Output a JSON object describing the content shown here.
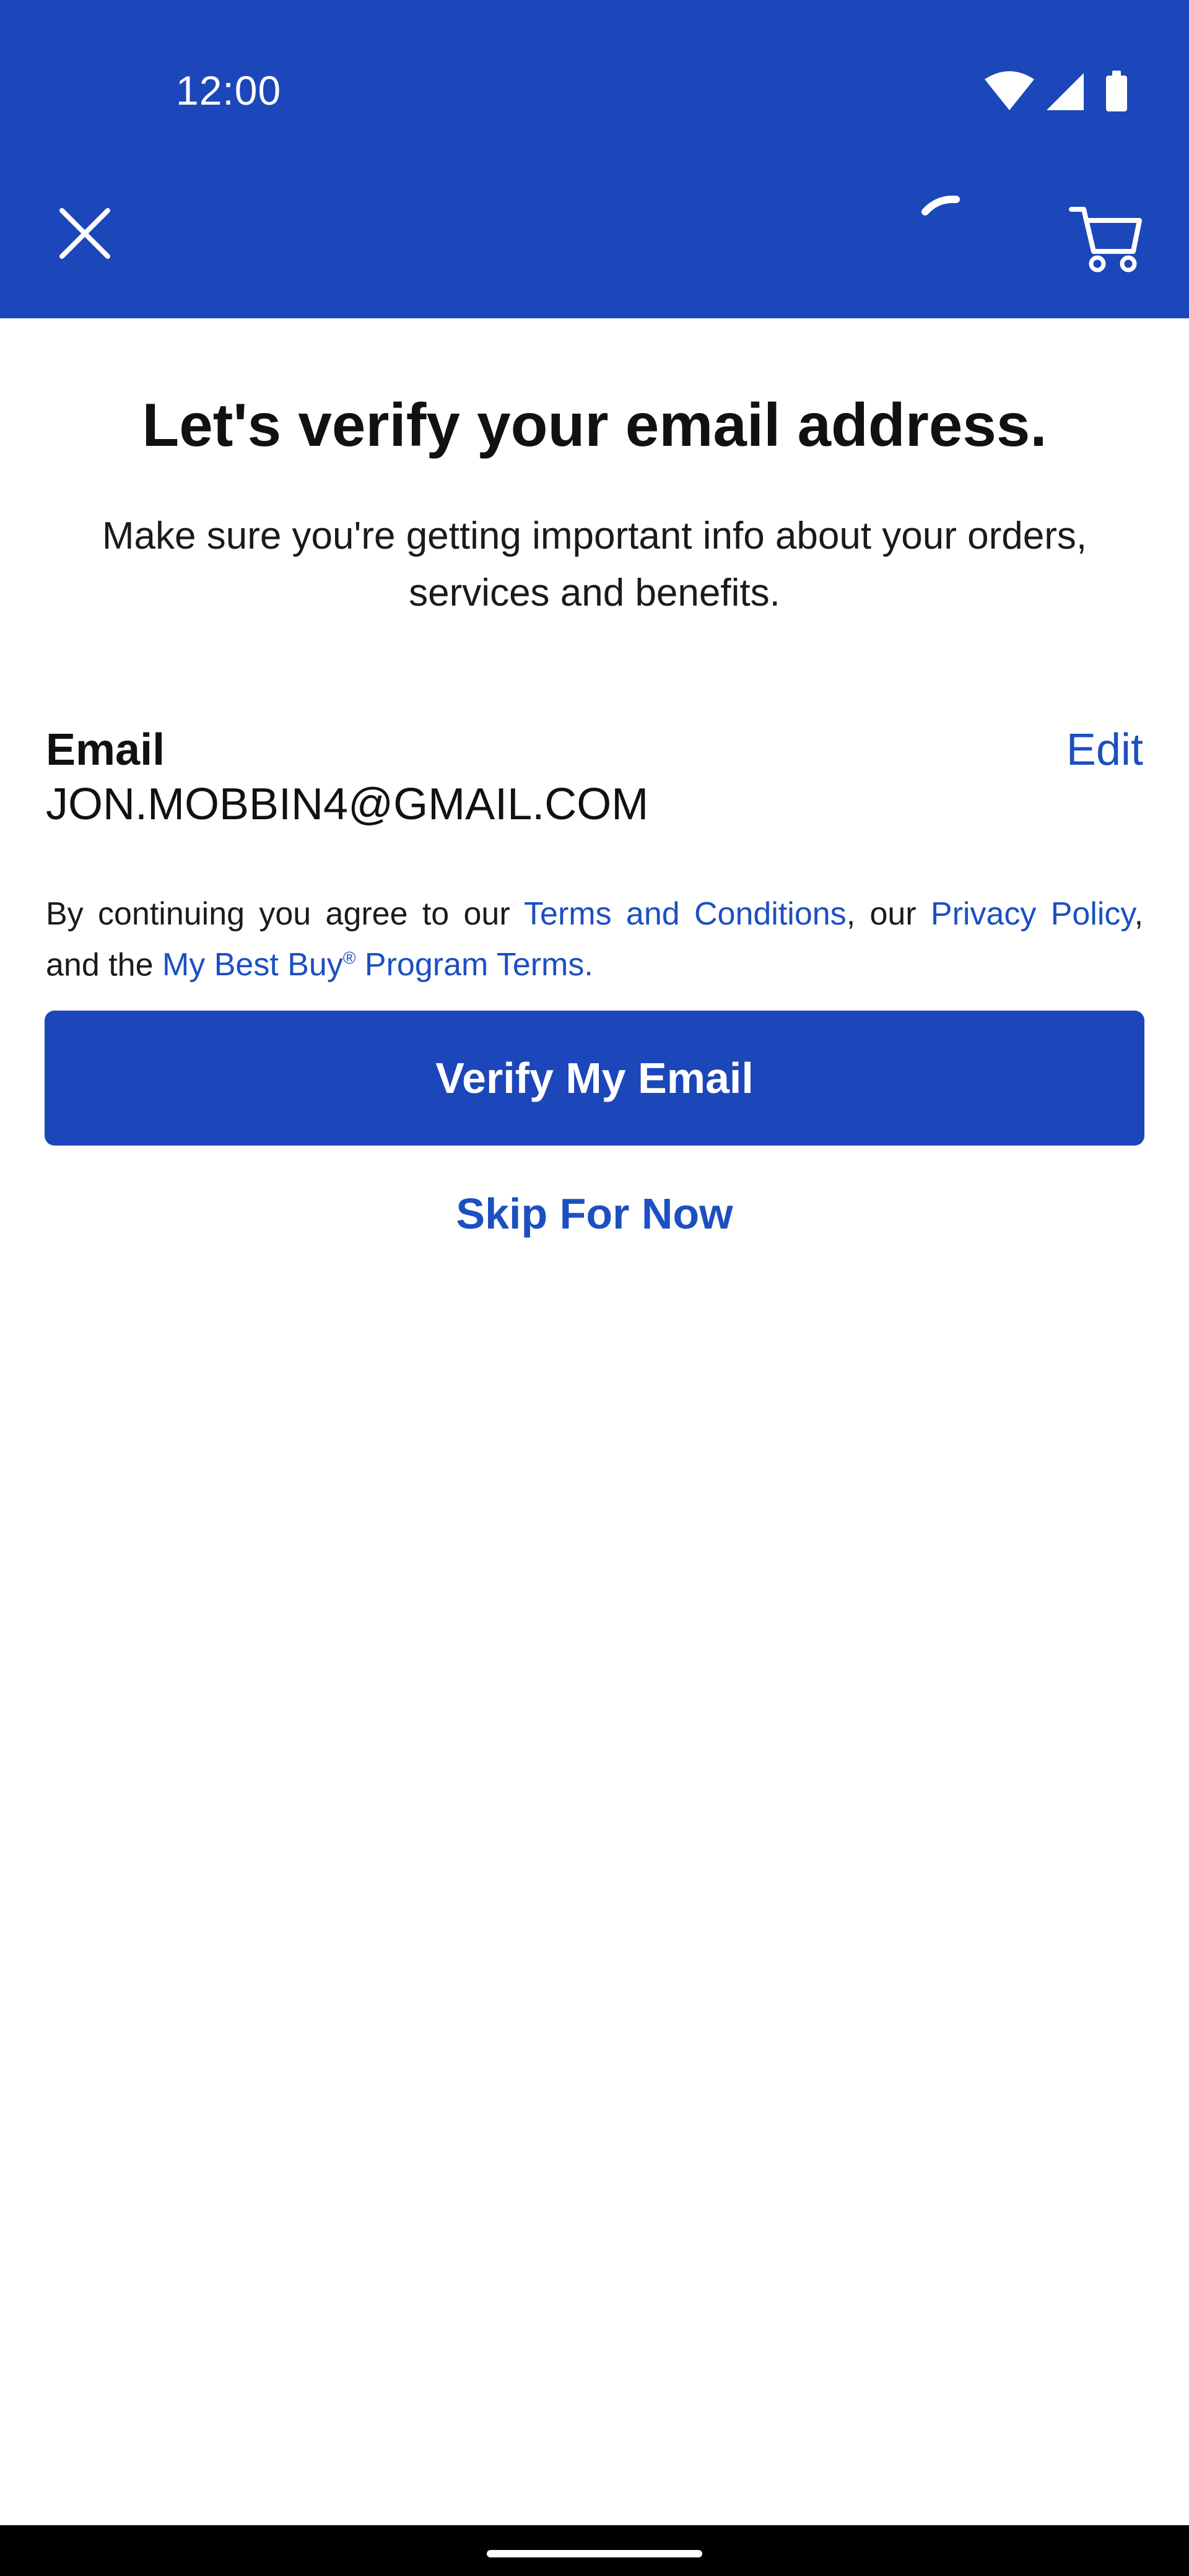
{
  "status_bar": {
    "time": "12:00",
    "icons": [
      "wifi-icon",
      "signal-icon",
      "battery-icon"
    ]
  },
  "header": {
    "close_icon": "close-icon",
    "cart_icon": "cart-icon",
    "background_color": "#1c47ba"
  },
  "main": {
    "title": "Let's verify your email address.",
    "subtitle": "Make sure you're getting important info about your orders, services and benefits.",
    "email_label": "Email",
    "email_value": "JON.MOBBIN4@GMAIL.COM",
    "edit_label": "Edit",
    "legal": {
      "prefix": "By continuing you agree to our ",
      "terms_link": "Terms and Conditions",
      "middle": ", our ",
      "privacy_link": "Privacy Policy",
      "and_the": ", and the ",
      "program_link_prefix": "My Best Buy",
      "registered_mark": "®",
      "program_link_suffix": " Program Terms."
    },
    "verify_button": "Verify My Email",
    "skip_button": "Skip For Now"
  },
  "colors": {
    "brand_blue": "#1c47ba",
    "link_blue": "#1c4fc1"
  }
}
